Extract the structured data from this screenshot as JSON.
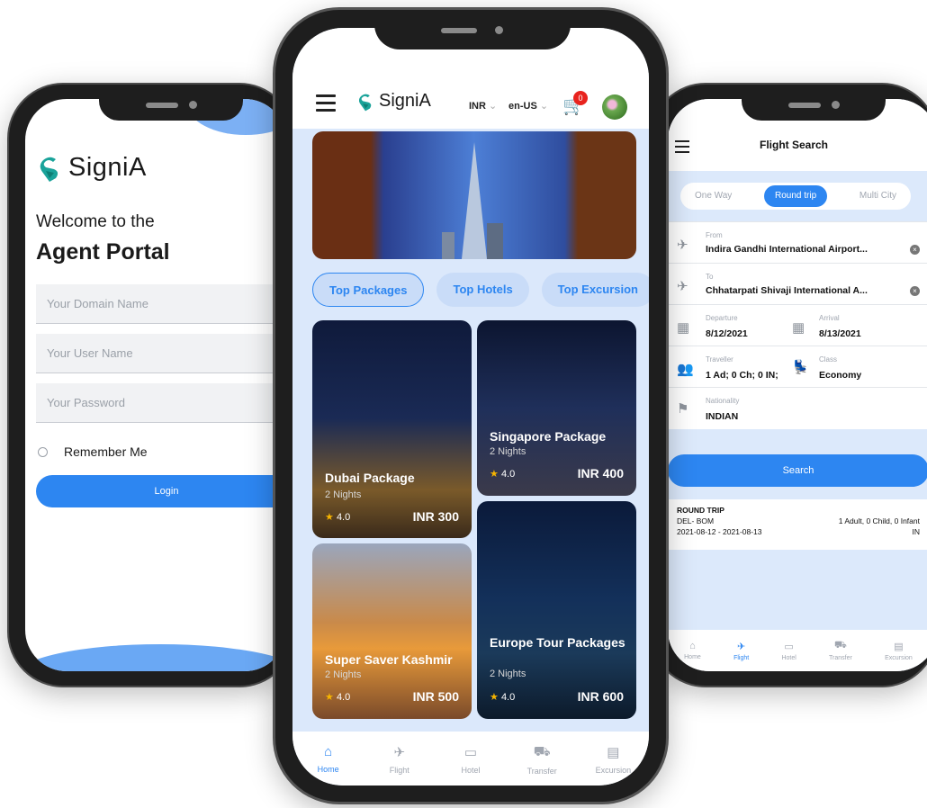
{
  "brand": {
    "name": "SigniA",
    "color": "#2d86f1",
    "logo_color": "#1aa39a"
  },
  "login_screen": {
    "welcome": "Welcome to the",
    "portal": "Agent Portal",
    "domain_placeholder": "Your Domain Name",
    "user_placeholder": "Your User Name",
    "password_placeholder": "Your Password",
    "remember_me": "Remember Me",
    "login_button": "Login"
  },
  "home_screen": {
    "currency": "INR",
    "locale": "en-US",
    "cart_count": "0",
    "tabs": [
      "Top Packages",
      "Top Hotels",
      "Top Excursion"
    ],
    "packages": [
      {
        "title": "Dubai Package",
        "nights": "2 Nights",
        "rating": "4.0",
        "price": "INR 300"
      },
      {
        "title": "Singapore Package",
        "nights": "2 Nights",
        "rating": "4.0",
        "price": "INR 400"
      },
      {
        "title": "Super Saver Kashmir",
        "nights": "2 Nights",
        "rating": "4.0",
        "price": "INR 500"
      },
      {
        "title": "Europe Tour Packages",
        "nights": "2 Nights",
        "rating": "4.0",
        "price": "INR 600"
      }
    ],
    "nav": [
      {
        "label": "Home",
        "icon": "home-icon"
      },
      {
        "label": "Flight",
        "icon": "plane-icon"
      },
      {
        "label": "Hotel",
        "icon": "bed-icon"
      },
      {
        "label": "Transfer",
        "icon": "car-icon"
      },
      {
        "label": "Excursion",
        "icon": "bus-icon"
      }
    ]
  },
  "flight_screen": {
    "title": "Flight Search",
    "trip_types": [
      "One Way",
      "Round trip",
      "Multi City"
    ],
    "from_label": "From",
    "from_value": "Indira Gandhi International Airport...",
    "to_label": "To",
    "to_value": "Chhatarpati Shivaji International A...",
    "departure_label": "Departure",
    "departure_value": "8/12/2021",
    "arrival_label": "Arrival",
    "arrival_value": "8/13/2021",
    "traveller_label": "Traveller",
    "traveller_value": "1 Ad; 0 Ch; 0 IN;",
    "class_label": "Class",
    "class_value": "Economy",
    "nationality_label": "Nationality",
    "nationality_value": "INDIAN",
    "search_button": "Search",
    "summary": {
      "type": "ROUND TRIP",
      "route": "DEL- BOM",
      "pax": "1 Adult, 0 Child, 0 Infant",
      "dates": "2021-08-12 - 2021-08-13",
      "country": "IN"
    },
    "nav": [
      "Home",
      "Flight",
      "Hotel",
      "Transfer",
      "Excursion"
    ]
  }
}
